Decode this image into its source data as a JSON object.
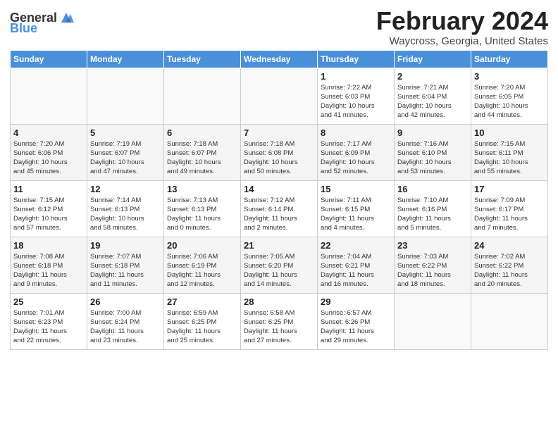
{
  "logo": {
    "text_general": "General",
    "text_blue": "Blue"
  },
  "title": "February 2024",
  "location": "Waycross, Georgia, United States",
  "headers": [
    "Sunday",
    "Monday",
    "Tuesday",
    "Wednesday",
    "Thursday",
    "Friday",
    "Saturday"
  ],
  "weeks": [
    [
      {
        "day": "",
        "info": ""
      },
      {
        "day": "",
        "info": ""
      },
      {
        "day": "",
        "info": ""
      },
      {
        "day": "",
        "info": ""
      },
      {
        "day": "1",
        "info": "Sunrise: 7:22 AM\nSunset: 6:03 PM\nDaylight: 10 hours\nand 41 minutes."
      },
      {
        "day": "2",
        "info": "Sunrise: 7:21 AM\nSunset: 6:04 PM\nDaylight: 10 hours\nand 42 minutes."
      },
      {
        "day": "3",
        "info": "Sunrise: 7:20 AM\nSunset: 6:05 PM\nDaylight: 10 hours\nand 44 minutes."
      }
    ],
    [
      {
        "day": "4",
        "info": "Sunrise: 7:20 AM\nSunset: 6:06 PM\nDaylight: 10 hours\nand 45 minutes."
      },
      {
        "day": "5",
        "info": "Sunrise: 7:19 AM\nSunset: 6:07 PM\nDaylight: 10 hours\nand 47 minutes."
      },
      {
        "day": "6",
        "info": "Sunrise: 7:18 AM\nSunset: 6:07 PM\nDaylight: 10 hours\nand 49 minutes."
      },
      {
        "day": "7",
        "info": "Sunrise: 7:18 AM\nSunset: 6:08 PM\nDaylight: 10 hours\nand 50 minutes."
      },
      {
        "day": "8",
        "info": "Sunrise: 7:17 AM\nSunset: 6:09 PM\nDaylight: 10 hours\nand 52 minutes."
      },
      {
        "day": "9",
        "info": "Sunrise: 7:16 AM\nSunset: 6:10 PM\nDaylight: 10 hours\nand 53 minutes."
      },
      {
        "day": "10",
        "info": "Sunrise: 7:15 AM\nSunset: 6:11 PM\nDaylight: 10 hours\nand 55 minutes."
      }
    ],
    [
      {
        "day": "11",
        "info": "Sunrise: 7:15 AM\nSunset: 6:12 PM\nDaylight: 10 hours\nand 57 minutes."
      },
      {
        "day": "12",
        "info": "Sunrise: 7:14 AM\nSunset: 6:13 PM\nDaylight: 10 hours\nand 58 minutes."
      },
      {
        "day": "13",
        "info": "Sunrise: 7:13 AM\nSunset: 6:13 PM\nDaylight: 11 hours\nand 0 minutes."
      },
      {
        "day": "14",
        "info": "Sunrise: 7:12 AM\nSunset: 6:14 PM\nDaylight: 11 hours\nand 2 minutes."
      },
      {
        "day": "15",
        "info": "Sunrise: 7:11 AM\nSunset: 6:15 PM\nDaylight: 11 hours\nand 4 minutes."
      },
      {
        "day": "16",
        "info": "Sunrise: 7:10 AM\nSunset: 6:16 PM\nDaylight: 11 hours\nand 5 minutes."
      },
      {
        "day": "17",
        "info": "Sunrise: 7:09 AM\nSunset: 6:17 PM\nDaylight: 11 hours\nand 7 minutes."
      }
    ],
    [
      {
        "day": "18",
        "info": "Sunrise: 7:08 AM\nSunset: 6:18 PM\nDaylight: 11 hours\nand 9 minutes."
      },
      {
        "day": "19",
        "info": "Sunrise: 7:07 AM\nSunset: 6:18 PM\nDaylight: 11 hours\nand 11 minutes."
      },
      {
        "day": "20",
        "info": "Sunrise: 7:06 AM\nSunset: 6:19 PM\nDaylight: 11 hours\nand 12 minutes."
      },
      {
        "day": "21",
        "info": "Sunrise: 7:05 AM\nSunset: 6:20 PM\nDaylight: 11 hours\nand 14 minutes."
      },
      {
        "day": "22",
        "info": "Sunrise: 7:04 AM\nSunset: 6:21 PM\nDaylight: 11 hours\nand 16 minutes."
      },
      {
        "day": "23",
        "info": "Sunrise: 7:03 AM\nSunset: 6:22 PM\nDaylight: 11 hours\nand 18 minutes."
      },
      {
        "day": "24",
        "info": "Sunrise: 7:02 AM\nSunset: 6:22 PM\nDaylight: 11 hours\nand 20 minutes."
      }
    ],
    [
      {
        "day": "25",
        "info": "Sunrise: 7:01 AM\nSunset: 6:23 PM\nDaylight: 11 hours\nand 22 minutes."
      },
      {
        "day": "26",
        "info": "Sunrise: 7:00 AM\nSunset: 6:24 PM\nDaylight: 11 hours\nand 23 minutes."
      },
      {
        "day": "27",
        "info": "Sunrise: 6:59 AM\nSunset: 6:25 PM\nDaylight: 11 hours\nand 25 minutes."
      },
      {
        "day": "28",
        "info": "Sunrise: 6:58 AM\nSunset: 6:25 PM\nDaylight: 11 hours\nand 27 minutes."
      },
      {
        "day": "29",
        "info": "Sunrise: 6:57 AM\nSunset: 6:26 PM\nDaylight: 11 hours\nand 29 minutes."
      },
      {
        "day": "",
        "info": ""
      },
      {
        "day": "",
        "info": ""
      }
    ]
  ]
}
